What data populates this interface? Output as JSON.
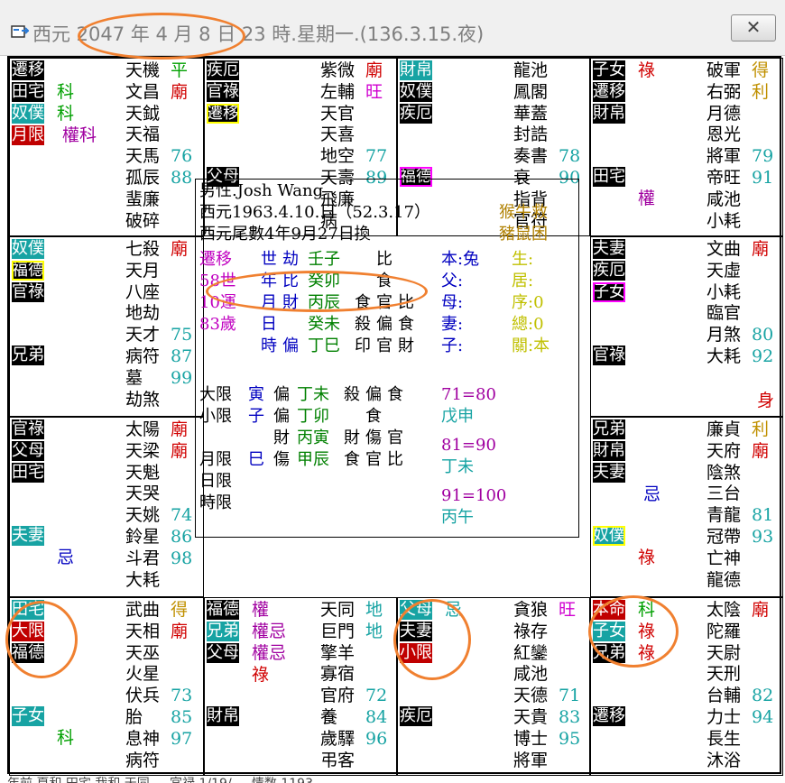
{
  "window": {
    "title": "西元 2047 年 4 月 8 日 23 時.星期一.(136.3.15.夜)",
    "close_label": "✕",
    "status_text": "年前 夏和 田宅 我和 天同 ... 宮禄 1/19/ ... 情数 1193"
  },
  "cells": [
    {
      "id": "si",
      "palaces": [
        {
          "text": "遷移",
          "style": "blk"
        },
        {
          "text": "田宅",
          "style": "blk"
        },
        {
          "text": "奴僕",
          "style": "teal"
        },
        {
          "text": "月限",
          "style": "red"
        }
      ],
      "annotations": [
        {
          "text": "科",
          "color": "#00a000",
          "row": 1,
          "col": 0
        },
        {
          "text": "科",
          "color": "#00a000",
          "row": 2,
          "col": 0
        },
        {
          "text": "權科",
          "color": "#a000a0",
          "row": 3,
          "col": 1
        }
      ],
      "stars": [
        {
          "text": "天機",
          "tag": "平",
          "tagColor": "#00a000"
        },
        {
          "text": "文昌",
          "tag": "廟",
          "tagColor": "#d00000"
        },
        {
          "text": "天鉞",
          "tag": ""
        },
        {
          "text": "天福",
          "tag": ""
        },
        {
          "text": "天馬",
          "num": "76"
        },
        {
          "text": "孤辰",
          "num": "88"
        },
        {
          "text": "蜚廉"
        },
        {
          "text": "破碎"
        }
      ]
    },
    {
      "id": "wu",
      "palaces": [
        {
          "text": "疾厄",
          "style": "blk"
        },
        {
          "text": "官祿",
          "style": "blk"
        },
        {
          "text": "遷移",
          "style": "blkfr"
        },
        {
          "text": "父母",
          "style": "blk",
          "gap": 1
        }
      ],
      "annotations": [],
      "stars": [
        {
          "text": "紫微",
          "tag": "廟",
          "tagColor": "#d00000"
        },
        {
          "text": "左輔",
          "tag": "旺",
          "tagColor": "#d000d0"
        },
        {
          "text": "天官"
        },
        {
          "text": "天喜"
        },
        {
          "text": "地空",
          "num": "77"
        },
        {
          "text": "天壽",
          "num": "89"
        },
        {
          "text": "飛廉"
        },
        {
          "text": "病"
        }
      ]
    },
    {
      "id": "wei",
      "palaces": [
        {
          "text": "財帛",
          "style": "teal"
        },
        {
          "text": "奴僕",
          "style": "blk"
        },
        {
          "text": "疾厄",
          "style": "blk"
        },
        {
          "text": "福德",
          "style": "blkmg",
          "gap": 1
        }
      ],
      "annotations": [],
      "stars": [
        {
          "text": "龍池"
        },
        {
          "text": "鳳閣"
        },
        {
          "text": "華蓋"
        },
        {
          "text": "封誥"
        },
        {
          "text": "奏書",
          "num": "78"
        },
        {
          "text": "衰",
          "num": "90"
        },
        {
          "text": "指背"
        },
        {
          "text": "官符"
        }
      ]
    },
    {
      "id": "shen",
      "palaces": [
        {
          "text": "子女",
          "style": "blk"
        },
        {
          "text": "遷移",
          "style": "blk"
        },
        {
          "text": "財帛",
          "style": "blk"
        },
        {
          "text": "田宅",
          "style": "blk",
          "gap": 1
        }
      ],
      "annotations": [
        {
          "text": "祿",
          "color": "#d00000",
          "row": 0,
          "col": 0
        },
        {
          "text": "權",
          "color": "#a000a0",
          "row": 4,
          "col": 0
        }
      ],
      "stars": [
        {
          "text": "破軍",
          "tag": "得",
          "tagColor": "#c09000"
        },
        {
          "text": "右弼",
          "tag": "利",
          "tagColor": "#c09000"
        },
        {
          "text": "月德"
        },
        {
          "text": "恩光"
        },
        {
          "text": "將軍",
          "num": "79"
        },
        {
          "text": "帝旺",
          "num": "91"
        },
        {
          "text": "咸池"
        },
        {
          "text": "小耗"
        }
      ]
    },
    {
      "id": "chen",
      "palaces": [
        {
          "text": "奴僕",
          "style": "teal"
        },
        {
          "text": "福德",
          "style": "blkfr"
        },
        {
          "text": "官祿",
          "style": "blk"
        },
        {
          "text": "兄弟",
          "style": "blk",
          "gap": 1
        }
      ],
      "annotations": [],
      "stars": [
        {
          "text": "七殺",
          "tag": "廟",
          "tagColor": "#d00000"
        },
        {
          "text": "天月"
        },
        {
          "text": "八座"
        },
        {
          "text": "地劫"
        },
        {
          "text": "天才",
          "num": "75"
        },
        {
          "text": "病符",
          "num": "87"
        },
        {
          "text": "墓",
          "num": "99"
        },
        {
          "text": "劫煞"
        }
      ]
    },
    {
      "id": "you",
      "palaces": [
        {
          "text": "夫妻",
          "style": "blk"
        },
        {
          "text": "疾厄",
          "style": "blk"
        },
        {
          "text": "子女",
          "style": "blkmg"
        },
        {
          "text": "官祿",
          "style": "blk",
          "gap": 1
        }
      ],
      "annotations": [
        {
          "text": "身",
          "color": "#d00000",
          "row": 7,
          "col": 9
        }
      ],
      "stars": [
        {
          "text": "文曲",
          "tag": "廟",
          "tagColor": "#d00000"
        },
        {
          "text": "天虛"
        },
        {
          "text": "小耗"
        },
        {
          "text": "臨官"
        },
        {
          "text": "月煞",
          "num": "80"
        },
        {
          "text": "大耗",
          "num": "92"
        }
      ]
    },
    {
      "id": "mao",
      "palaces": [
        {
          "text": "官祿",
          "style": "blk"
        },
        {
          "text": "父母",
          "style": "blk"
        },
        {
          "text": "田宅",
          "style": "blk"
        },
        {
          "text": "夫妻",
          "style": "teal",
          "gap": 1
        }
      ],
      "annotations": [
        {
          "text": "忌",
          "color": "#0000c0",
          "row": 4,
          "col": 0
        }
      ],
      "stars": [
        {
          "text": "太陽",
          "tag": "廟",
          "tagColor": "#d00000"
        },
        {
          "text": "天梁",
          "tag": "廟",
          "tagColor": "#d00000"
        },
        {
          "text": "天魁"
        },
        {
          "text": "天哭"
        },
        {
          "text": "天姚",
          "num": "74"
        },
        {
          "text": "鈴星",
          "num": "86"
        },
        {
          "text": "斗君",
          "num": "98"
        },
        {
          "text": "大耗"
        }
      ]
    },
    {
      "id": "xu",
      "palaces": [
        {
          "text": "兄弟",
          "style": "blk"
        },
        {
          "text": "財帛",
          "style": "blk"
        },
        {
          "text": "夫妻",
          "style": "blk"
        },
        {
          "text": "奴僕",
          "style": "tealfr",
          "gap": 1
        }
      ],
      "annotations": [
        {
          "text": "忌",
          "color": "#0000c0",
          "row": 3,
          "col": 1
        },
        {
          "text": "祿",
          "color": "#d00000",
          "row": 4,
          "col": 0
        }
      ],
      "stars": [
        {
          "text": "廉貞",
          "tag": "利",
          "tagColor": "#c09000"
        },
        {
          "text": "天府",
          "tag": "廟",
          "tagColor": "#d00000"
        },
        {
          "text": "陰煞"
        },
        {
          "text": "三台"
        },
        {
          "text": "青龍",
          "num": "81"
        },
        {
          "text": "冠帶",
          "num": "93"
        },
        {
          "text": "亡神"
        },
        {
          "text": "龍德"
        }
      ]
    },
    {
      "id": "yin",
      "palaces": [
        {
          "text": "田宅",
          "style": "teal"
        },
        {
          "text": "大限",
          "style": "red"
        },
        {
          "text": "福德",
          "style": "blk"
        },
        {
          "text": "子女",
          "style": "teal",
          "gap": 1
        }
      ],
      "annotations": [
        {
          "text": "科",
          "color": "#00a000",
          "row": 4,
          "col": 0
        }
      ],
      "stars": [
        {
          "text": "武曲",
          "tag": "得",
          "tagColor": "#c09000"
        },
        {
          "text": "天相",
          "tag": "廟",
          "tagColor": "#d00000"
        },
        {
          "text": "天巫"
        },
        {
          "text": "火星"
        },
        {
          "text": "伏兵",
          "num": "73"
        },
        {
          "text": "胎",
          "num": "85"
        },
        {
          "text": "息神",
          "num": "97"
        },
        {
          "text": "病符"
        }
      ]
    },
    {
      "id": "chou",
      "palaces": [
        {
          "text": "福德",
          "style": "blk"
        },
        {
          "text": "兄弟",
          "style": "teal"
        },
        {
          "text": "父母",
          "style": "blk"
        },
        {
          "text": "財帛",
          "style": "blk",
          "gap": 1
        }
      ],
      "annotations": [
        {
          "text": "權",
          "color": "#a000a0",
          "row": 0,
          "col": 0
        },
        {
          "text": "權忌",
          "color": "#a000a0",
          "row": 1,
          "col": 0
        },
        {
          "text": "權忌",
          "color": "#a000a0",
          "row": 2,
          "col": 0
        },
        {
          "text": "祿",
          "color": "#d00000",
          "row": 3,
          "col": 0
        }
      ],
      "stars": [
        {
          "text": "天同",
          "tag": "地",
          "tagColor": "#17a3a3"
        },
        {
          "text": "巨門",
          "tag": "地",
          "tagColor": "#17a3a3"
        },
        {
          "text": "擎羊"
        },
        {
          "text": "寡宿"
        },
        {
          "text": "官府",
          "num": "72"
        },
        {
          "text": "養",
          "num": "84"
        },
        {
          "text": "歲驛",
          "num": "96"
        },
        {
          "text": "弔客"
        }
      ]
    },
    {
      "id": "zi",
      "palaces": [
        {
          "text": "父母",
          "style": "teal"
        },
        {
          "text": "夫妻",
          "style": "blk"
        },
        {
          "text": "小限",
          "style": "red"
        },
        {
          "text": "疾厄",
          "style": "blk",
          "gap": 1
        }
      ],
      "annotations": [
        {
          "text": "忌",
          "color": "#17a3a3",
          "row": 0,
          "col": 0
        }
      ],
      "stars": [
        {
          "text": "貪狼",
          "tag": "旺",
          "tagColor": "#d000d0"
        },
        {
          "text": "祿存"
        },
        {
          "text": "紅鑾"
        },
        {
          "text": "咸池"
        },
        {
          "text": "天德",
          "num": "71"
        },
        {
          "text": "天貴",
          "num": "83"
        },
        {
          "text": "博士",
          "num": "95"
        },
        {
          "text": "將軍"
        }
      ]
    },
    {
      "id": "hai",
      "palaces": [
        {
          "text": "本命",
          "style": "red"
        },
        {
          "text": "子女",
          "style": "teal"
        },
        {
          "text": "兄弟",
          "style": "blk"
        },
        {
          "text": "遷移",
          "style": "blk",
          "gap": 1
        }
      ],
      "annotations": [
        {
          "text": "科",
          "color": "#00a000",
          "row": 0,
          "col": 0
        },
        {
          "text": "祿",
          "color": "#d00000",
          "row": 1,
          "col": 0
        },
        {
          "text": "祿",
          "color": "#d00000",
          "row": 2,
          "col": 0
        }
      ],
      "stars": [
        {
          "text": "太陰",
          "tag": "廟",
          "tagColor": "#d00000"
        },
        {
          "text": "陀羅"
        },
        {
          "text": "天尉"
        },
        {
          "text": "天刑"
        },
        {
          "text": "台輔",
          "num": "82"
        },
        {
          "text": "力士",
          "num": "94"
        },
        {
          "text": "長生"
        },
        {
          "text": "沐浴"
        }
      ]
    }
  ],
  "center": {
    "line1": "男性.Josh Wang",
    "line2": "西元1963.4.10.日（52.3.17）",
    "line3": "西元尾數4年9月27日換",
    "side_tl": "猴牛救",
    "side_tl2": "豬鼠困",
    "col_a": [
      "遷移",
      "58世",
      "10運",
      "83歲"
    ],
    "col_b": [
      "世",
      "年",
      "月",
      "日",
      "時"
    ],
    "col_c": [
      "劫",
      "比",
      "財",
      "",
      "偏"
    ],
    "col_d": [
      "壬子",
      "癸卯",
      "丙辰",
      "癸未",
      "丁巳"
    ],
    "col_e": [
      "",
      "",
      "食",
      "殺",
      "印"
    ],
    "col_f": [
      "比",
      "食",
      "官",
      "偏",
      "官"
    ],
    "col_g": [
      "",
      "",
      "比",
      "食",
      "財"
    ],
    "col_h": [
      "本:兔",
      "父:",
      "母:",
      "妻:",
      "子:"
    ],
    "col_i": [
      "生:",
      "居:",
      "序:0",
      "總:0",
      "關:本"
    ],
    "daxian_rows": [
      {
        "a": "大限",
        "b": "寅",
        "c": "偏",
        "d": "丁未",
        "e": "殺",
        "f": "偏",
        "g": "食"
      },
      {
        "a": "小限",
        "b": "子",
        "c": "偏",
        "d": "丁卯",
        "e": "",
        "f": "食",
        "g": ""
      },
      {
        "a": "",
        "b": "",
        "c": "財",
        "d": "丙寅",
        "e": "財",
        "f": "傷",
        "g": "官"
      },
      {
        "a": "月限",
        "b": "巳",
        "c": "傷",
        "d": "甲辰",
        "e": "食",
        "f": "官",
        "g": "比"
      },
      {
        "a": "日限",
        "b": "",
        "c": "",
        "d": "",
        "e": "",
        "f": "",
        "g": ""
      },
      {
        "a": "時限",
        "b": "",
        "c": "",
        "d": "",
        "e": "",
        "f": "",
        "g": ""
      }
    ],
    "range1": "71=80",
    "range1b": "戊申",
    "range2": "81=90",
    "range2b": "丁未",
    "range3": "91=100",
    "range3b": "丙午"
  }
}
